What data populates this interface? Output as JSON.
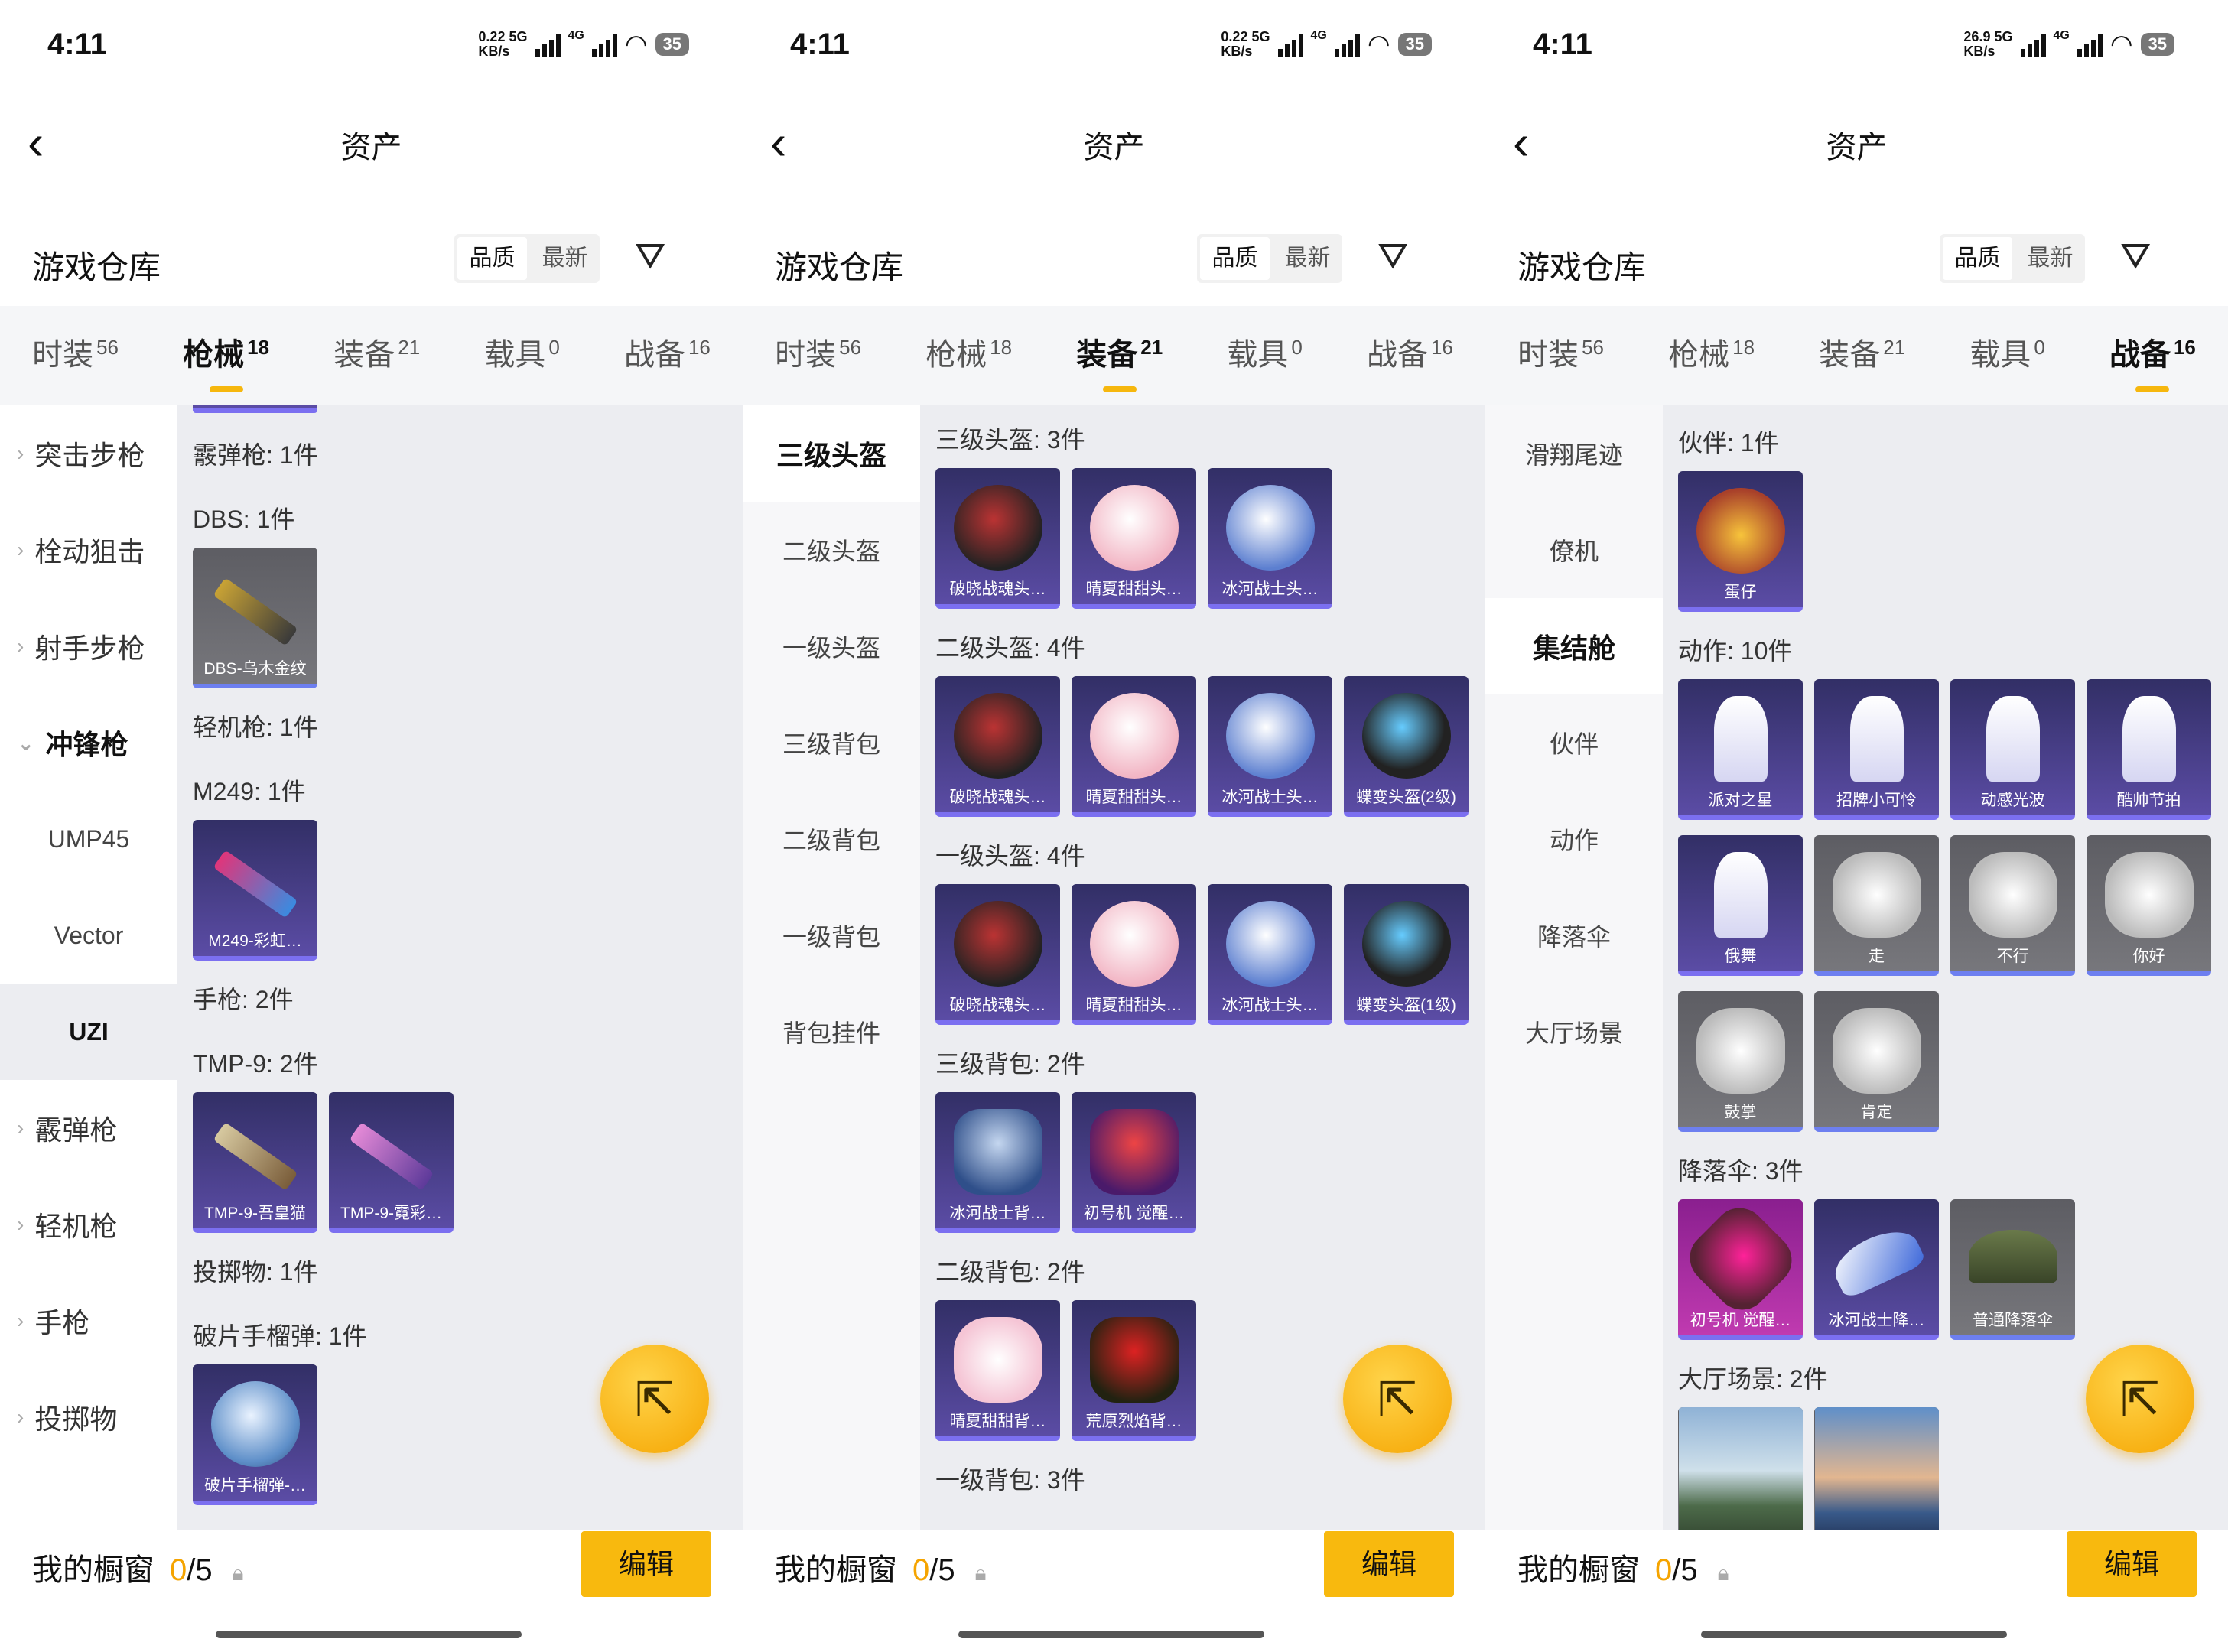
{
  "status": {
    "time": "4:11",
    "speeds": [
      "0.22",
      "0.22",
      "26.9"
    ],
    "speed_unit": "KB/s",
    "net5g": "5G",
    "net4g": "4G",
    "battery": "35"
  },
  "header": {
    "back": "‹",
    "title": "资产"
  },
  "warehouse": {
    "title": "游戏仓库",
    "sort_quality": "品质",
    "sort_latest": "最新"
  },
  "tabs": [
    {
      "label": "时装",
      "count": "56"
    },
    {
      "label": "枪械",
      "count": "18"
    },
    {
      "label": "装备",
      "count": "21"
    },
    {
      "label": "载具",
      "count": "0"
    },
    {
      "label": "战备",
      "count": "16"
    }
  ],
  "panel1": {
    "side": [
      "突击步枪",
      "栓动狙击",
      "射手步枪",
      "冲锋枪",
      "UMP45",
      "Vector",
      "UZI",
      "霰弹枪",
      "轻机枪",
      "手枪",
      "投掷物"
    ],
    "headers": [
      "霰弹枪: 1件",
      "DBS: 1件",
      "轻机枪: 1件",
      "M249: 1件",
      "手枪: 2件",
      "TMP-9: 2件",
      "投掷物: 1件",
      "破片手榴弹: 1件"
    ],
    "cards": [
      "DBS-乌木金纹",
      "M249-彩虹…",
      "TMP-9-吾皇猫",
      "TMP-9-霓彩…",
      "破片手榴弹-…"
    ]
  },
  "panel2": {
    "side": [
      "三级头盔",
      "二级头盔",
      "一级头盔",
      "三级背包",
      "二级背包",
      "一级背包",
      "背包挂件"
    ],
    "headers": [
      "三级头盔: 3件",
      "二级头盔: 4件",
      "一级头盔: 4件",
      "三级背包: 2件",
      "二级背包: 2件",
      "一级背包: 3件"
    ],
    "cards": [
      "破晓战魂头…",
      "晴夏甜甜头…",
      "冰河战士头…",
      "破晓战魂头…",
      "晴夏甜甜头…",
      "冰河战士头…",
      "蝶变头盔(2级)",
      "破晓战魂头…",
      "晴夏甜甜头…",
      "冰河战士头…",
      "蝶变头盔(1级)",
      "冰河战士背…",
      "初号机 觉醒…",
      "晴夏甜甜背…",
      "荒原烈焰背…"
    ]
  },
  "panel3": {
    "side": [
      "滑翔尾迹",
      "僚机",
      "集结舱",
      "伙伴",
      "动作",
      "降落伞",
      "大厅场景"
    ],
    "headers": [
      "伙伴: 1件",
      "动作: 10件",
      "降落伞: 3件",
      "大厅场景: 2件"
    ],
    "cards": [
      "蛋仔",
      "派对之星",
      "招牌小可怜",
      "动感光波",
      "酷帅节拍",
      "俄舞",
      "走",
      "不行",
      "你好",
      "鼓掌",
      "肯定",
      "初号机 觉醒…",
      "冰河战士降…",
      "普通降落伞"
    ]
  },
  "showcase": {
    "title": "我的橱窗",
    "count_current": "0",
    "count_total": "/5",
    "edit": "编辑"
  },
  "colors": {
    "accent": "#f5a400",
    "card_purple": "#4a3f8e",
    "bg_gray": "#ecedf1"
  }
}
